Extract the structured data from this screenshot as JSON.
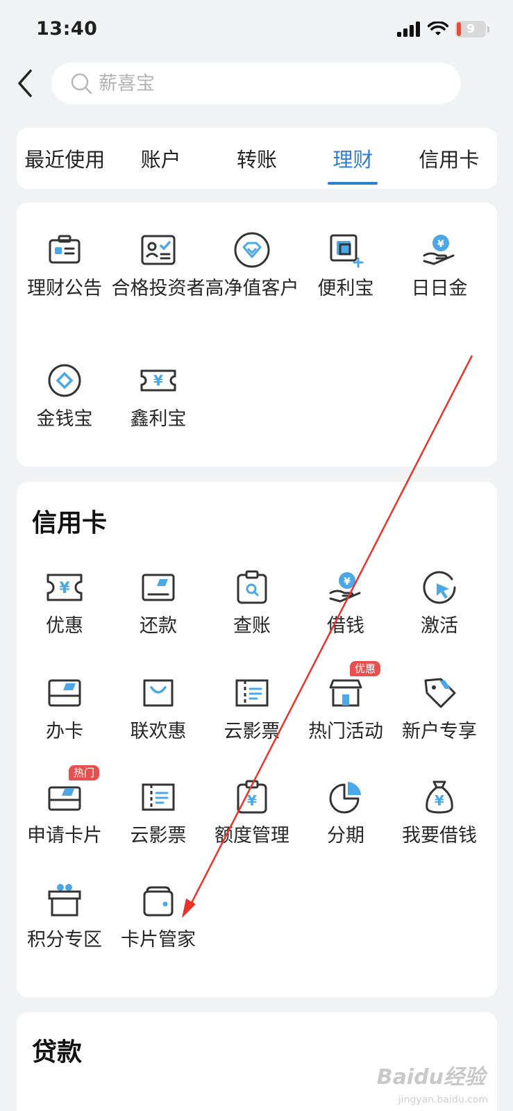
{
  "status": {
    "time": "13:40",
    "battery": "9"
  },
  "search": {
    "placeholder": "薪喜宝"
  },
  "tabs": [
    {
      "label": "最近使用"
    },
    {
      "label": "账户"
    },
    {
      "label": "转账"
    },
    {
      "label": "理财",
      "active": true
    },
    {
      "label": "信用卡"
    }
  ],
  "licai": {
    "items": [
      {
        "label": "理财公告",
        "icon": "announcement-icon"
      },
      {
        "label": "合格投资者",
        "icon": "id-card-check-icon"
      },
      {
        "label": "高净值客户",
        "icon": "diamond-icon"
      },
      {
        "label": "便利宝",
        "icon": "square-plus-icon"
      },
      {
        "label": "日日金",
        "icon": "hand-coin-icon"
      },
      {
        "label": "金钱宝",
        "icon": "coin-diamond-icon"
      },
      {
        "label": "鑫利宝",
        "icon": "yen-ticket-icon"
      }
    ]
  },
  "credit": {
    "title": "信用卡",
    "items": [
      {
        "label": "优惠",
        "icon": "yen-ticket-icon"
      },
      {
        "label": "还款",
        "icon": "card-edit-icon"
      },
      {
        "label": "查账",
        "icon": "clipboard-search-icon"
      },
      {
        "label": "借钱",
        "icon": "hand-coin-icon"
      },
      {
        "label": "激活",
        "icon": "cursor-circle-icon"
      },
      {
        "label": "办卡",
        "icon": "bank-card-icon"
      },
      {
        "label": "联欢惠",
        "icon": "shopping-bag-icon"
      },
      {
        "label": "云影票",
        "icon": "film-ticket-icon"
      },
      {
        "label": "热门活动",
        "icon": "store-icon",
        "badge": "优惠"
      },
      {
        "label": "新户专享",
        "icon": "tag-icon"
      },
      {
        "label": "申请卡片",
        "icon": "bank-card-icon",
        "badge": "热门"
      },
      {
        "label": "云影票",
        "icon": "film-ticket-icon"
      },
      {
        "label": "额度管理",
        "icon": "clipboard-yen-icon"
      },
      {
        "label": "分期",
        "icon": "pie-chart-icon"
      },
      {
        "label": "我要借钱",
        "icon": "money-bag-icon"
      },
      {
        "label": "积分专区",
        "icon": "gift-icon"
      },
      {
        "label": "卡片管家",
        "icon": "wallet-icon"
      }
    ]
  },
  "loan": {
    "title": "贷款"
  },
  "watermark": {
    "text": "Baidu经验",
    "sub": "jingyan.baidu.com"
  },
  "colors": {
    "accent": "#2f7fd1",
    "icon_stroke": "#333333",
    "icon_fill": "#4aa8e8",
    "badge": "#e8504f",
    "arrow": "#e8322a"
  }
}
